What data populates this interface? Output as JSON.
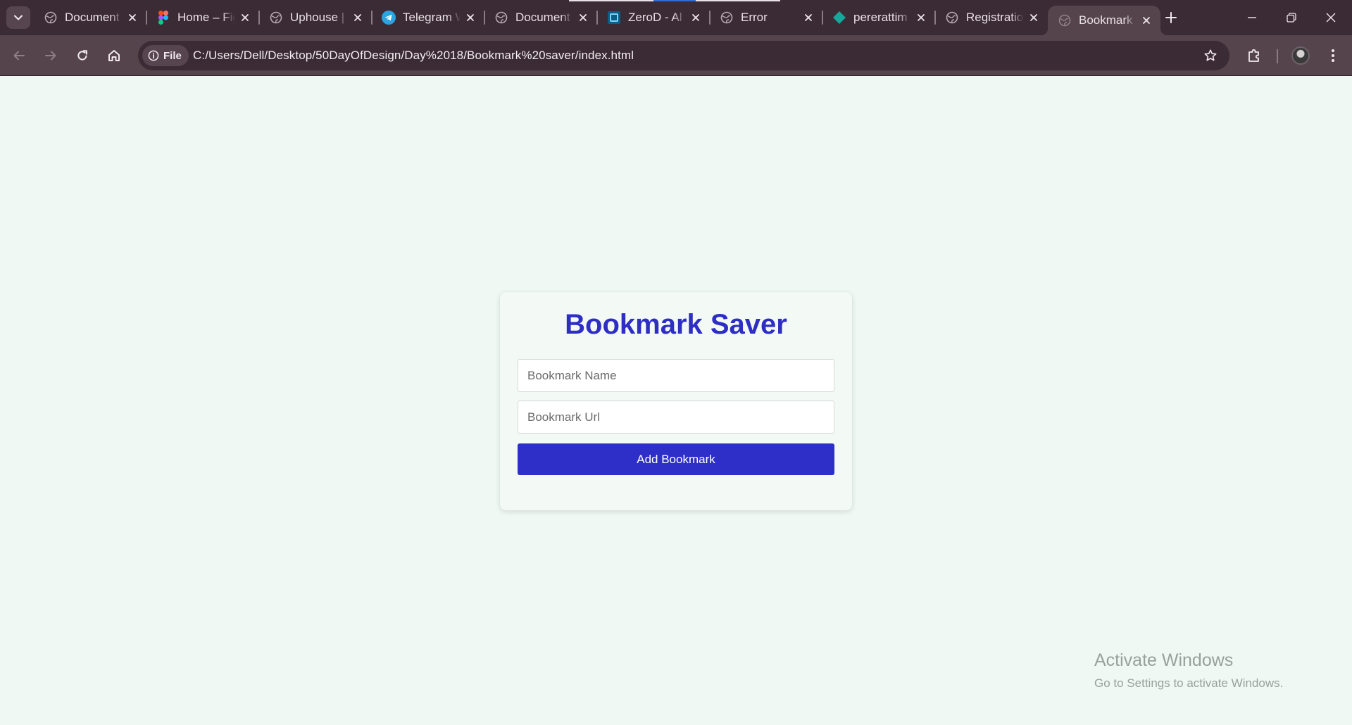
{
  "browser": {
    "tabs": [
      {
        "title": "Document",
        "icon": "globe-icon",
        "active": false
      },
      {
        "title": "Home – Figma",
        "icon": "figma-icon",
        "active": false
      },
      {
        "title": "Uphouse | ",
        "icon": "globe-icon",
        "active": false
      },
      {
        "title": "Telegram Web",
        "icon": "telegram-icon",
        "active": false
      },
      {
        "title": "Document",
        "icon": "globe-icon",
        "active": false
      },
      {
        "title": "ZeroD - Al",
        "icon": "zerod-icon",
        "active": false
      },
      {
        "title": "Error",
        "icon": "globe-icon",
        "active": false
      },
      {
        "title": "pererattim",
        "icon": "diamond-icon",
        "active": false
      },
      {
        "title": "Registration",
        "icon": "globe-icon",
        "active": false
      },
      {
        "title": "Bookmark",
        "icon": "globe-icon",
        "active": true
      }
    ],
    "address": {
      "chip_label": "File",
      "url": "C:/Users/Dell/Desktop/50DayOfDesign/Day%2018/Bookmark%20saver/index.html"
    },
    "colors": {
      "tabbar": "#3b2b34",
      "toolbar": "#55444c"
    }
  },
  "page": {
    "title": "Bookmark Saver",
    "name_placeholder": "Bookmark Name",
    "url_placeholder": "Bookmark Url",
    "name_value": "",
    "url_value": "",
    "add_button_label": "Add Bookmark",
    "colors": {
      "accent": "#2e2ec9",
      "background": "#eff8f3"
    }
  },
  "watermark": {
    "line1": "Activate Windows",
    "line2": "Go to Settings to activate Windows."
  }
}
